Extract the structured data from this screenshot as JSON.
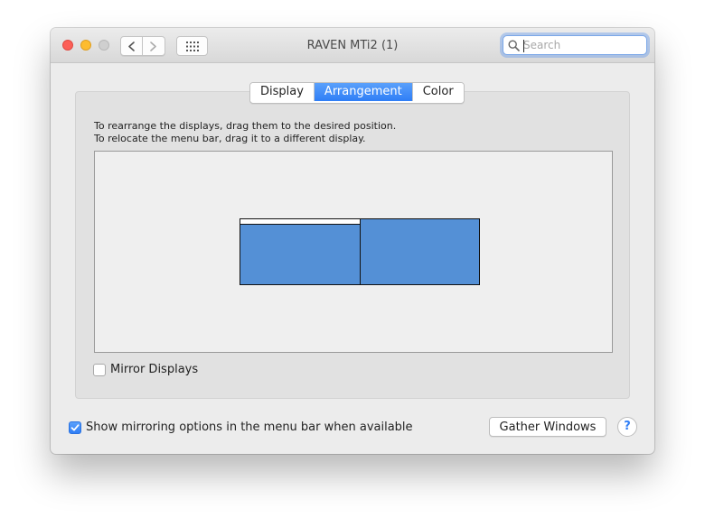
{
  "window": {
    "title": "RAVEN MTi2 (1)"
  },
  "toolbar": {
    "back_icon": "chevron-left-icon",
    "forward_icon": "chevron-right-icon",
    "grid_icon": "show-all-grid-icon"
  },
  "search": {
    "placeholder": "Search",
    "value": ""
  },
  "tabs": [
    {
      "label": "Display",
      "active": false
    },
    {
      "label": "Arrangement",
      "active": true
    },
    {
      "label": "Color",
      "active": false
    }
  ],
  "arrangement": {
    "instruction_line1": "To rearrange the displays, drag them to the desired position.",
    "instruction_line2": "To relocate the menu bar, drag it to a different display.",
    "display_color": "#5490d6"
  },
  "mirror_displays": {
    "label": "Mirror Displays",
    "checked": false
  },
  "show_mirroring": {
    "label": "Show mirroring options in the menu bar when available",
    "checked": true
  },
  "buttons": {
    "gather_windows": "Gather Windows",
    "help": "?"
  },
  "colors": {
    "accent": "#2f7ef6",
    "close": "#fc5f57",
    "minimize": "#fdbc2e",
    "zoom_disabled": "#cfcfcf"
  }
}
